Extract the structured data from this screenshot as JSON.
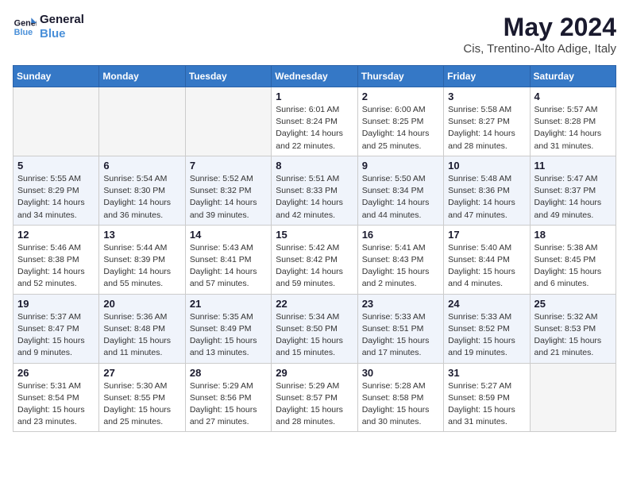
{
  "header": {
    "logo_line1": "General",
    "logo_line2": "Blue",
    "month_year": "May 2024",
    "location": "Cis, Trentino-Alto Adige, Italy"
  },
  "days_of_week": [
    "Sunday",
    "Monday",
    "Tuesday",
    "Wednesday",
    "Thursday",
    "Friday",
    "Saturday"
  ],
  "weeks": [
    [
      {
        "num": "",
        "info": ""
      },
      {
        "num": "",
        "info": ""
      },
      {
        "num": "",
        "info": ""
      },
      {
        "num": "1",
        "info": "Sunrise: 6:01 AM\nSunset: 8:24 PM\nDaylight: 14 hours\nand 22 minutes."
      },
      {
        "num": "2",
        "info": "Sunrise: 6:00 AM\nSunset: 8:25 PM\nDaylight: 14 hours\nand 25 minutes."
      },
      {
        "num": "3",
        "info": "Sunrise: 5:58 AM\nSunset: 8:27 PM\nDaylight: 14 hours\nand 28 minutes."
      },
      {
        "num": "4",
        "info": "Sunrise: 5:57 AM\nSunset: 8:28 PM\nDaylight: 14 hours\nand 31 minutes."
      }
    ],
    [
      {
        "num": "5",
        "info": "Sunrise: 5:55 AM\nSunset: 8:29 PM\nDaylight: 14 hours\nand 34 minutes."
      },
      {
        "num": "6",
        "info": "Sunrise: 5:54 AM\nSunset: 8:30 PM\nDaylight: 14 hours\nand 36 minutes."
      },
      {
        "num": "7",
        "info": "Sunrise: 5:52 AM\nSunset: 8:32 PM\nDaylight: 14 hours\nand 39 minutes."
      },
      {
        "num": "8",
        "info": "Sunrise: 5:51 AM\nSunset: 8:33 PM\nDaylight: 14 hours\nand 42 minutes."
      },
      {
        "num": "9",
        "info": "Sunrise: 5:50 AM\nSunset: 8:34 PM\nDaylight: 14 hours\nand 44 minutes."
      },
      {
        "num": "10",
        "info": "Sunrise: 5:48 AM\nSunset: 8:36 PM\nDaylight: 14 hours\nand 47 minutes."
      },
      {
        "num": "11",
        "info": "Sunrise: 5:47 AM\nSunset: 8:37 PM\nDaylight: 14 hours\nand 49 minutes."
      }
    ],
    [
      {
        "num": "12",
        "info": "Sunrise: 5:46 AM\nSunset: 8:38 PM\nDaylight: 14 hours\nand 52 minutes."
      },
      {
        "num": "13",
        "info": "Sunrise: 5:44 AM\nSunset: 8:39 PM\nDaylight: 14 hours\nand 55 minutes."
      },
      {
        "num": "14",
        "info": "Sunrise: 5:43 AM\nSunset: 8:41 PM\nDaylight: 14 hours\nand 57 minutes."
      },
      {
        "num": "15",
        "info": "Sunrise: 5:42 AM\nSunset: 8:42 PM\nDaylight: 14 hours\nand 59 minutes."
      },
      {
        "num": "16",
        "info": "Sunrise: 5:41 AM\nSunset: 8:43 PM\nDaylight: 15 hours\nand 2 minutes."
      },
      {
        "num": "17",
        "info": "Sunrise: 5:40 AM\nSunset: 8:44 PM\nDaylight: 15 hours\nand 4 minutes."
      },
      {
        "num": "18",
        "info": "Sunrise: 5:38 AM\nSunset: 8:45 PM\nDaylight: 15 hours\nand 6 minutes."
      }
    ],
    [
      {
        "num": "19",
        "info": "Sunrise: 5:37 AM\nSunset: 8:47 PM\nDaylight: 15 hours\nand 9 minutes."
      },
      {
        "num": "20",
        "info": "Sunrise: 5:36 AM\nSunset: 8:48 PM\nDaylight: 15 hours\nand 11 minutes."
      },
      {
        "num": "21",
        "info": "Sunrise: 5:35 AM\nSunset: 8:49 PM\nDaylight: 15 hours\nand 13 minutes."
      },
      {
        "num": "22",
        "info": "Sunrise: 5:34 AM\nSunset: 8:50 PM\nDaylight: 15 hours\nand 15 minutes."
      },
      {
        "num": "23",
        "info": "Sunrise: 5:33 AM\nSunset: 8:51 PM\nDaylight: 15 hours\nand 17 minutes."
      },
      {
        "num": "24",
        "info": "Sunrise: 5:33 AM\nSunset: 8:52 PM\nDaylight: 15 hours\nand 19 minutes."
      },
      {
        "num": "25",
        "info": "Sunrise: 5:32 AM\nSunset: 8:53 PM\nDaylight: 15 hours\nand 21 minutes."
      }
    ],
    [
      {
        "num": "26",
        "info": "Sunrise: 5:31 AM\nSunset: 8:54 PM\nDaylight: 15 hours\nand 23 minutes."
      },
      {
        "num": "27",
        "info": "Sunrise: 5:30 AM\nSunset: 8:55 PM\nDaylight: 15 hours\nand 25 minutes."
      },
      {
        "num": "28",
        "info": "Sunrise: 5:29 AM\nSunset: 8:56 PM\nDaylight: 15 hours\nand 27 minutes."
      },
      {
        "num": "29",
        "info": "Sunrise: 5:29 AM\nSunset: 8:57 PM\nDaylight: 15 hours\nand 28 minutes."
      },
      {
        "num": "30",
        "info": "Sunrise: 5:28 AM\nSunset: 8:58 PM\nDaylight: 15 hours\nand 30 minutes."
      },
      {
        "num": "31",
        "info": "Sunrise: 5:27 AM\nSunset: 8:59 PM\nDaylight: 15 hours\nand 31 minutes."
      },
      {
        "num": "",
        "info": ""
      }
    ]
  ]
}
